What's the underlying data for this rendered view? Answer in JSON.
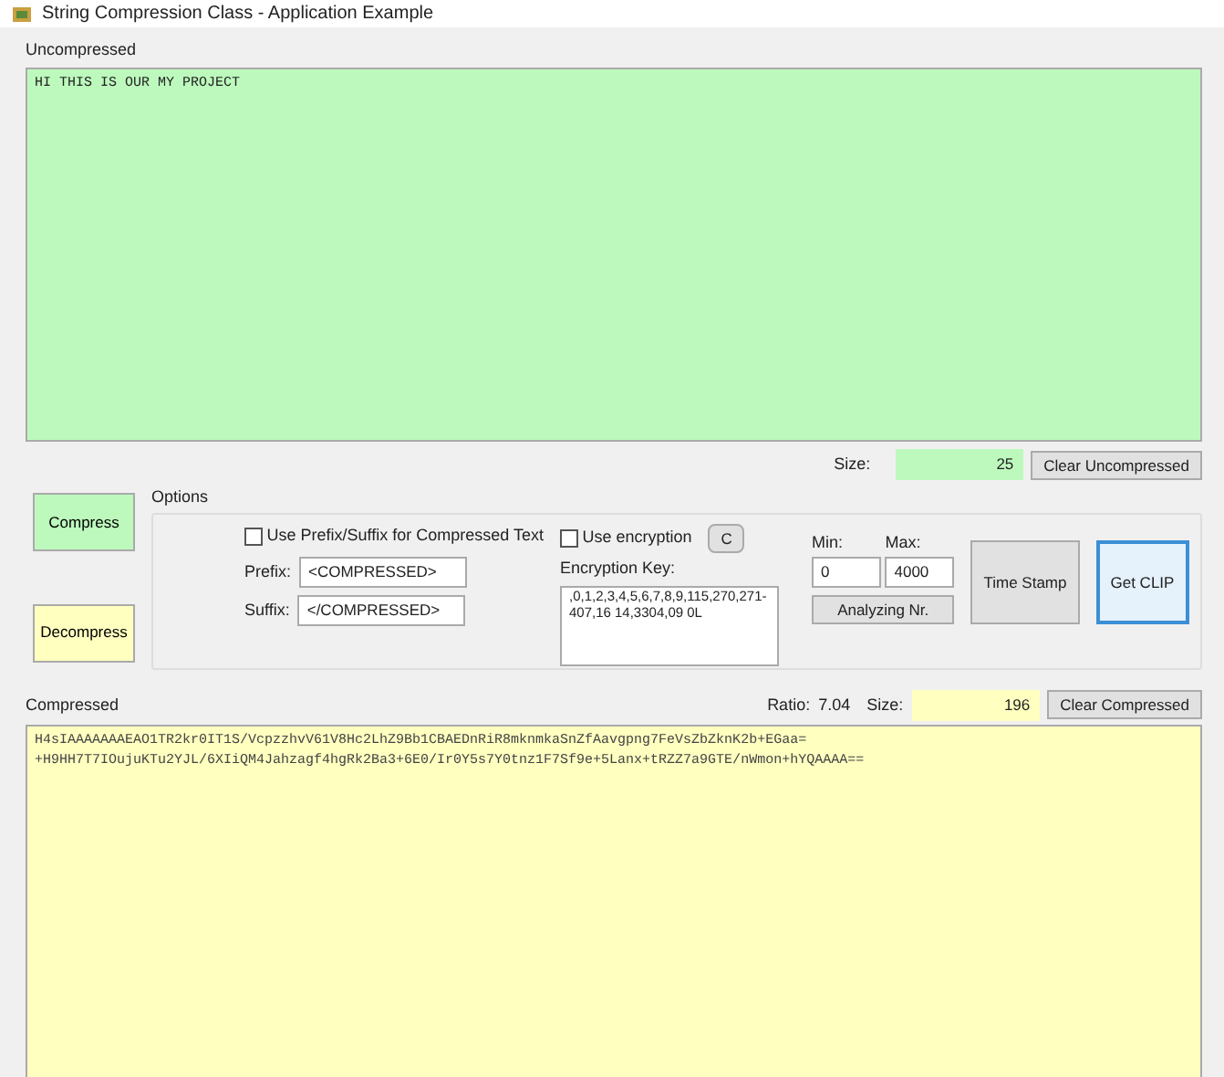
{
  "window": {
    "title": "String Compression Class - Application Example"
  },
  "uncompressed": {
    "label": "Uncompressed",
    "text": "HI THIS IS OUR MY PROJECT",
    "size_label": "Size:",
    "size": "25",
    "clear_button": "Clear Uncompressed"
  },
  "actions": {
    "compress": "Compress",
    "decompress": "Decompress"
  },
  "options": {
    "legend": "Options",
    "use_prefix": {
      "label": "Use Prefix/Suffix for Compressed Text",
      "checked": false
    },
    "prefix_label": "Prefix:",
    "prefix": "<COMPRESSED>",
    "suffix_label": "Suffix:",
    "suffix": "</COMPRESSED>",
    "use_encryption": {
      "label": "Use encryption",
      "checked": false
    },
    "c_button": "C",
    "key_label": "Encryption Key:",
    "key": ",0,1,2,3,4,5,6,7,8,9,115,270,271-407,16 14,3304,09 0L",
    "min_label": "Min:",
    "min": "0",
    "max_label": "Max:",
    "max": "4000",
    "analyze_button": "Analyzing Nr.",
    "timestamp_button": "Time Stamp",
    "getclip_button": "Get CLIP"
  },
  "compressed": {
    "label": "Compressed",
    "ratio_label": "Ratio:",
    "ratio": "7.04",
    "size_label": "Size:",
    "size": "196",
    "clear_button": "Clear Compressed",
    "lines": [
      "H4sIAAAAAAAEAO1TR2kr0IT1S/VcpzzhvV61V8Hc2LhZ9Bb1CBAEDnRiR8mknmkaSnZfAavgpng7FeVsZbZknK2b+EGaa=",
      "+H9HH7T7IOujuKTu2YJL/6XIiQM4Jahzagf4hgRk2Ba3+6E0/Ir0Y5s7Y0tnz1F7Sf9e+5Lanx+tRZZ7a9GTE/nWmon+hYQAAAA=="
    ]
  }
}
